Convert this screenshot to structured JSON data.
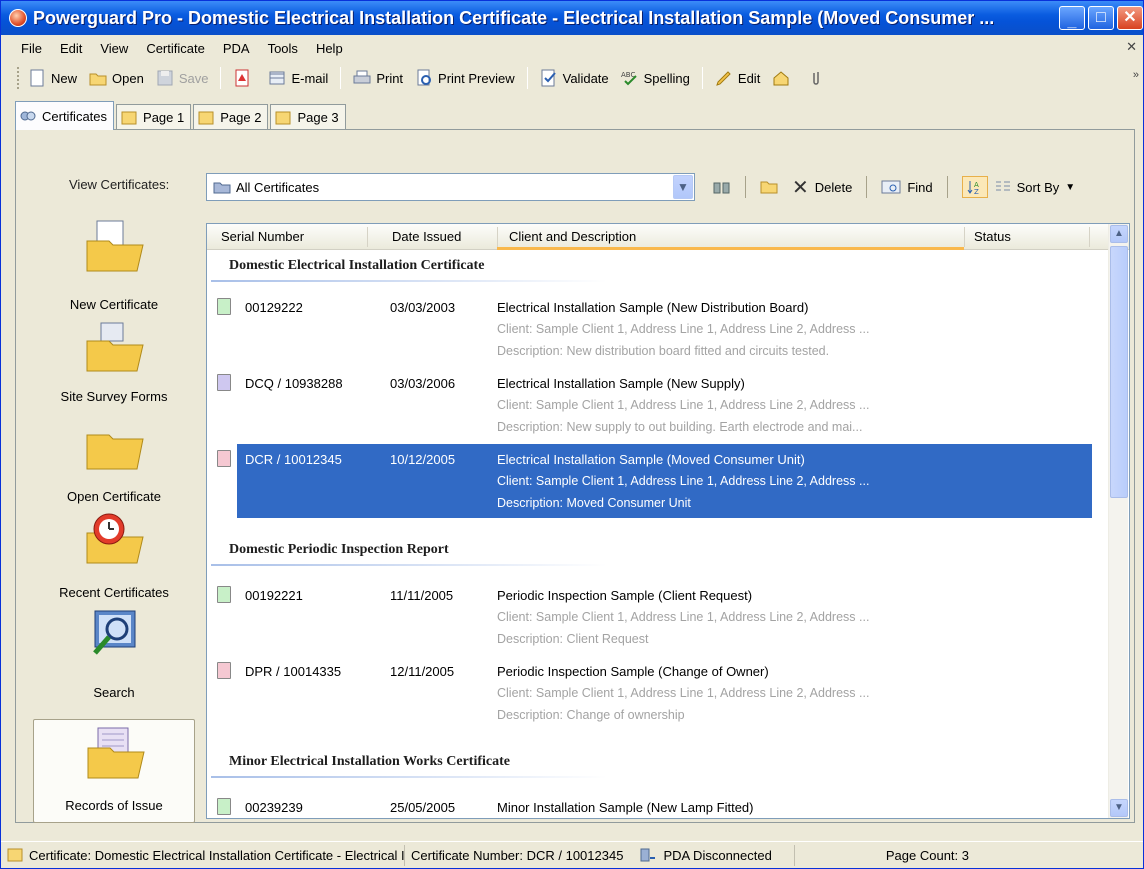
{
  "window": {
    "title": "Powerguard Pro - Domestic Electrical Installation Certificate - Electrical Installation Sample (Moved Consumer ..."
  },
  "menu": {
    "items": [
      "File",
      "Edit",
      "View",
      "Certificate",
      "PDA",
      "Tools",
      "Help"
    ]
  },
  "toolbar": {
    "new": "New",
    "open": "Open",
    "save": "Save",
    "email": "E-mail",
    "print": "Print",
    "print_preview": "Print Preview",
    "validate": "Validate",
    "spelling": "Spelling",
    "edit": "Edit"
  },
  "tabs": [
    "Certificates",
    "Page 1",
    "Page 2",
    "Page 3"
  ],
  "view": {
    "label": "View Certificates:",
    "selected": "All Certificates",
    "delete": "Delete",
    "find": "Find",
    "sort_by": "Sort By"
  },
  "nav": {
    "items": [
      "New Certificate",
      "Site Survey Forms",
      "Open Certificate",
      "Recent Certificates",
      "Search",
      "Records of Issue"
    ]
  },
  "list": {
    "columns": [
      "Serial Number",
      "Date Issued",
      "Client and Description",
      "Status"
    ],
    "groups": [
      {
        "title": "Domestic Electrical Installation Certificate",
        "rows": [
          {
            "serial": "00129222",
            "date": "03/03/2003",
            "title": "Electrical Installation Sample (New Distribution Board)",
            "client": "Client: Sample Client 1, Address Line 1, Address Line 2, Address ...",
            "description": "Description: New distribution board fitted and circuits tested."
          },
          {
            "serial": "DCQ / 10938288",
            "date": "03/03/2006",
            "title": "Electrical Installation Sample (New Supply)",
            "client": "Client: Sample Client 1, Address Line 1, Address Line 2, Address ...",
            "description": "Description: New supply to out building. Earth electrode and mai..."
          },
          {
            "serial": "DCR / 10012345",
            "date": "10/12/2005",
            "title": "Electrical Installation Sample (Moved Consumer Unit)",
            "client": "Client: Sample Client 1, Address Line 1, Address Line 2, Address ...",
            "description": "Description: Moved Consumer Unit"
          }
        ]
      },
      {
        "title": "Domestic Periodic Inspection Report",
        "rows": [
          {
            "serial": "00192221",
            "date": "11/11/2005",
            "title": "Periodic Inspection Sample (Client Request)",
            "client": "Client: Sample Client 1, Address Line 1, Address Line 2, Address ...",
            "description": "Description: Client Request"
          },
          {
            "serial": "DPR / 10014335",
            "date": "12/11/2005",
            "title": "Periodic Inspection Sample (Change of Owner)",
            "client": "Client: Sample Client 1, Address Line 1, Address Line 2, Address ...",
            "description": "Description: Change of ownership"
          }
        ]
      },
      {
        "title": "Minor Electrical Installation Works Certificate",
        "rows": [
          {
            "serial": "00239239",
            "date": "25/05/2005",
            "title": "Minor Installation Sample (New Lamp Fitted)"
          }
        ]
      }
    ]
  },
  "status": {
    "certificate": "Certificate: Domestic Electrical Installation Certificate - Electrical Install",
    "number": "Certificate Number: DCR / 10012345",
    "pda": "PDA Disconnected",
    "pages": "Page Count: 3"
  },
  "colors": {
    "selection": "#316ac5",
    "title_bar": "#0a5ce0",
    "green_doc": "#c8f0c8",
    "purple_doc": "#cfc8f0",
    "pink_doc": "#f5c8d2"
  }
}
